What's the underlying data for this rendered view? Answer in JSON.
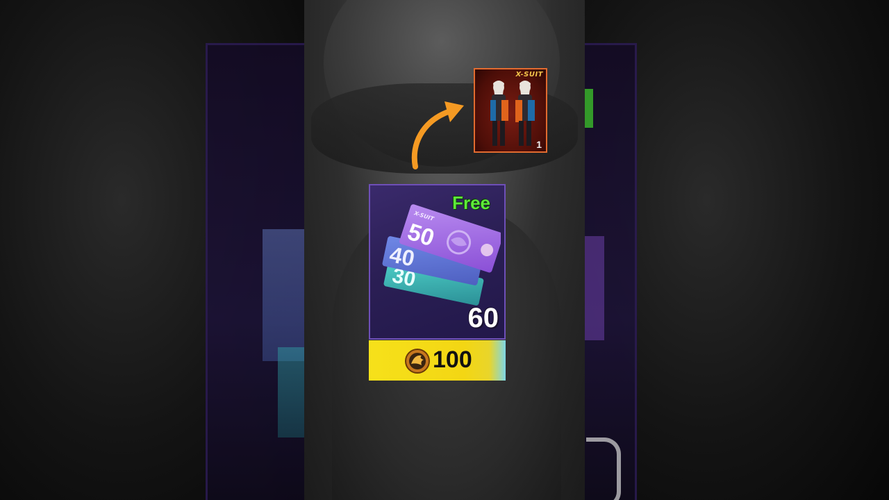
{
  "reward": {
    "badge_label": "X-SUIT",
    "count": "1",
    "icon": "x-suit-outfit-icon"
  },
  "offer": {
    "tag": "Free",
    "quantity": "60",
    "ticket_values": [
      "50",
      "40",
      "30"
    ],
    "ticket_header": "X-SUIT",
    "icon": "x-suit-ticket-icon"
  },
  "price": {
    "amount": "100",
    "currency_icon": "dragon-coin-icon"
  },
  "colors": {
    "free_tag": "#5dea39",
    "price_bar": "#f6e11a",
    "arrow": "#f59a23",
    "card_border": "#6e4fb8",
    "reward_border": "#e26b2f"
  }
}
